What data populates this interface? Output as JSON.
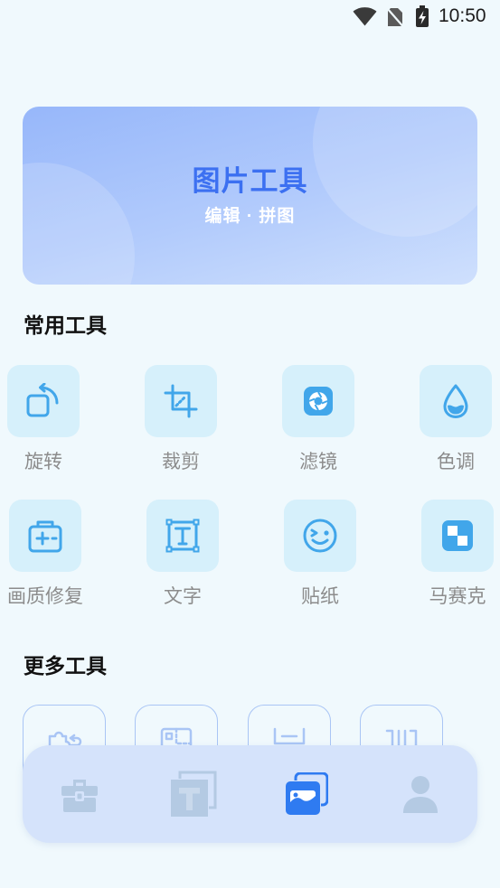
{
  "status_bar": {
    "time": "10:50",
    "icons": [
      "wifi-icon",
      "no-sim-icon",
      "battery-charging-icon"
    ]
  },
  "banner": {
    "title": "图片工具",
    "subtitle": "编辑 · 拼图"
  },
  "common_tools": {
    "title": "常用工具",
    "items": [
      {
        "label": "旋转",
        "icon": "rotate-icon"
      },
      {
        "label": "裁剪",
        "icon": "crop-icon"
      },
      {
        "label": "滤镜",
        "icon": "filter-icon"
      },
      {
        "label": "色调",
        "icon": "tone-drop-icon"
      },
      {
        "label": "画质修复",
        "icon": "enhance-icon"
      },
      {
        "label": "文字",
        "icon": "text-icon"
      },
      {
        "label": "贴纸",
        "icon": "sticker-icon"
      },
      {
        "label": "马赛克",
        "icon": "mosaic-icon"
      }
    ]
  },
  "more_tools": {
    "title": "更多工具",
    "items": [
      {
        "icon": "puzzle-icon"
      },
      {
        "icon": "collage-icon"
      },
      {
        "icon": "frame-icon"
      },
      {
        "icon": "split-icon"
      }
    ]
  },
  "bottom_nav": {
    "items": [
      {
        "icon": "toolbox-icon"
      },
      {
        "icon": "text-template-icon"
      },
      {
        "icon": "gallery-icon"
      },
      {
        "icon": "profile-icon"
      }
    ],
    "active_index": 2
  },
  "colors": {
    "bg": "#F0F9FD",
    "accent": "#2F7BF1",
    "tool-icon": "#41A6EA",
    "tool-tile": "#D6F0FB",
    "nav-bg": "#D5E3FB",
    "nav-inactive": "#B4CAE3",
    "banner-title": "#3C70F1",
    "outline": "#A9C5F5"
  }
}
